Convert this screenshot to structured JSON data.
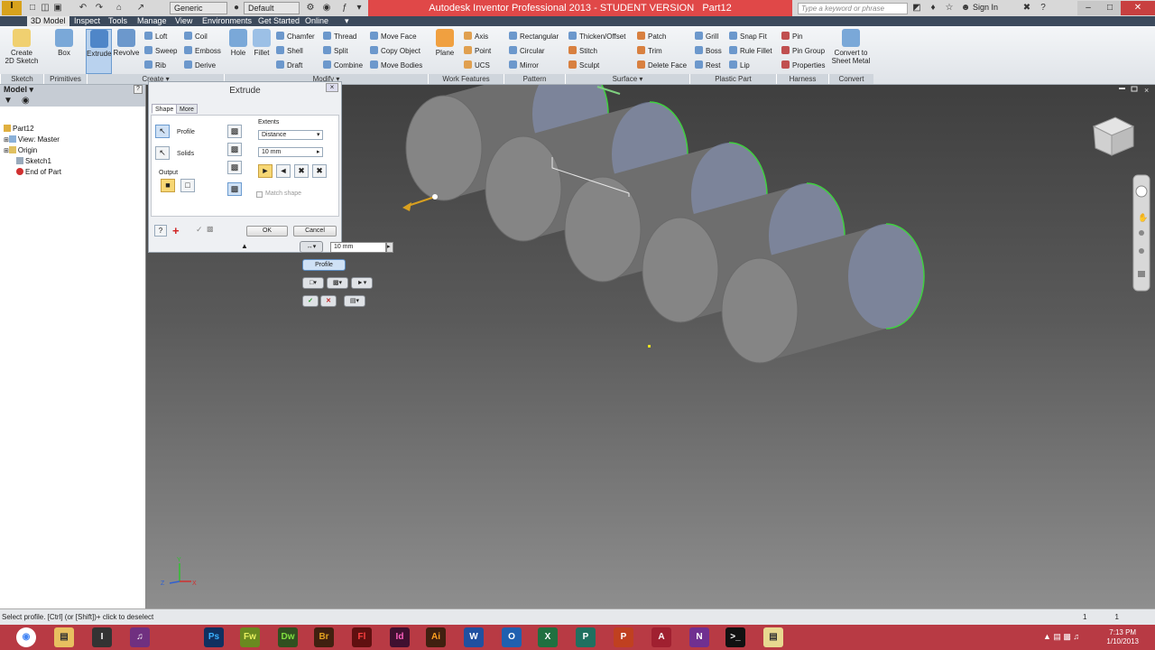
{
  "window": {
    "title": "Autodesk Inventor Professional 2013 - STUDENT VERSION",
    "document": "Part12",
    "search_placeholder": "Type a keyword or phrase",
    "sign_in": "Sign In",
    "material": "Generic",
    "appearance": "Default"
  },
  "tabs": [
    "3D Model",
    "Inspect",
    "Tools",
    "Manage",
    "View",
    "Environments",
    "Get Started",
    "Online"
  ],
  "ribbon": {
    "sketch": {
      "create_2d_sketch": "Create\n2D Sketch",
      "panel": "Sketch"
    },
    "primitives": {
      "box": "Box",
      "panel": "Primitives"
    },
    "create": {
      "extrude": "Extrude",
      "revolve": "Revolve",
      "loft": "Loft",
      "sweep": "Sweep",
      "rib": "Rib",
      "coil": "Coil",
      "emboss": "Emboss",
      "derive": "Derive",
      "panel": "Create ▾"
    },
    "modify": {
      "hole": "Hole",
      "fillet": "Fillet",
      "chamfer": "Chamfer",
      "shell": "Shell",
      "draft": "Draft",
      "thread": "Thread",
      "split": "Split",
      "combine": "Combine",
      "move_face": "Move Face",
      "copy_object": "Copy Object",
      "move_bodies": "Move Bodies",
      "panel": "Modify ▾"
    },
    "work_features": {
      "plane": "Plane",
      "axis": "Axis",
      "point": "Point",
      "ucs": "UCS",
      "panel": "Work Features"
    },
    "pattern": {
      "rectangular": "Rectangular",
      "circular": "Circular",
      "mirror": "Mirror",
      "panel": "Pattern"
    },
    "surface": {
      "thicken_offset": "Thicken/Offset",
      "stitch": "Stitch",
      "sculpt": "Sculpt",
      "patch": "Patch",
      "trim": "Trim",
      "delete_face": "Delete Face",
      "panel": "Surface ▾"
    },
    "plastic_part": {
      "grill": "Grill",
      "boss": "Boss",
      "rest": "Rest",
      "snap_fit": "Snap Fit",
      "rule_fillet": "Rule Fillet",
      "lip": "Lip",
      "panel": "Plastic Part"
    },
    "harness": {
      "pin": "Pin",
      "pin_group": "Pin Group",
      "properties": "Properties",
      "panel": "Harness"
    },
    "convert": {
      "convert_to_sheet_metal": "Convert to\nSheet Metal",
      "panel": "Convert"
    }
  },
  "browser": {
    "title": "Model ▾",
    "help": "?",
    "items": [
      {
        "label": "Part12"
      },
      {
        "label": "View: Master"
      },
      {
        "label": "Origin"
      },
      {
        "label": "Sketch1"
      },
      {
        "label": "End of Part"
      }
    ]
  },
  "dialog": {
    "title": "Extrude",
    "tab_shape": "Shape",
    "tab_more": "More",
    "profile": "Profile",
    "solids": "Solids",
    "output": "Output",
    "extents": "Extents",
    "extents_type": "Distance",
    "distance": "10 mm",
    "match_shape": "Match shape",
    "ok": "OK",
    "cancel": "Cancel"
  },
  "mini_toolbar": {
    "distance": "10 mm",
    "profile": "Profile"
  },
  "status": {
    "message": "Select profile. [Ctrl] (or [Shift])+ click to deselect",
    "count1": "1",
    "count2": "1"
  },
  "taskbar": {
    "apps": [
      "Chrome",
      "Explorer",
      "Inventor",
      "Media",
      "Ps",
      "Fw",
      "Dw",
      "Br",
      "Fl",
      "Id",
      "Ai",
      "W",
      "O",
      "X",
      "P",
      "P",
      "A",
      "N",
      "Cmd",
      "Folder"
    ],
    "time": "7:13 PM",
    "date": "1/10/2013"
  },
  "colors": {
    "title_bar": "#e04848",
    "tabs_bar": "#3c4a5c",
    "taskbar": "#b83a44",
    "cylinder": "#6e6e6e",
    "profile_highlight": "#8fa0d0"
  }
}
